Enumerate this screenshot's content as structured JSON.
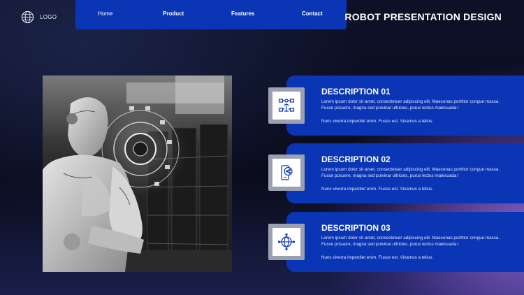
{
  "header": {
    "logo_text": "LOGO",
    "title": "ROBOT PRESENTATION DESIGN"
  },
  "nav": {
    "items": [
      {
        "label": "Home"
      },
      {
        "label": "Product"
      },
      {
        "label": "Features"
      },
      {
        "label": "Contact"
      }
    ]
  },
  "cards": [
    {
      "title": "DESCRIPTION 01",
      "body": "Lorem ipsum dolor sit amet, consectetuer adipiscing elit. Maecenas porttitor congue massa. Fusce posuere, magna sed pulvinar ultricies, purus lectus malesuada l",
      "body2": "Nunc viverra imperdiet enim. Fusce est. Vivamus a tellus.",
      "icon": "people-network-icon"
    },
    {
      "title": "DESCRIPTION 02",
      "body": "Lorem ipsum dolor sit amet, consectetuer adipiscing elit. Maecenas porttitor congue massa. Fusce posuere, magna sed pulvinar ultricies, purus lectus malesuada l",
      "body2": "Nunc viverra imperdiet enim. Fusce est. Vivamus a tellus.",
      "icon": "mobile-share-icon"
    },
    {
      "title": "DESCRIPTION 03",
      "body": "Lorem ipsum dolor sit amet, consectetuer adipiscing elit. Maecenas porttitor congue massa. Fusce posuere, magna sed pulvinar ultricies, purus lectus malesuada l",
      "body2": "Nunc viverra imperdiet enim. Fusce est. Vivamus a tellus.",
      "icon": "globe-network-icon"
    }
  ],
  "colors": {
    "accent": "#0a36b5",
    "background": "#0a0c1c",
    "glow": "#9a78e0"
  }
}
